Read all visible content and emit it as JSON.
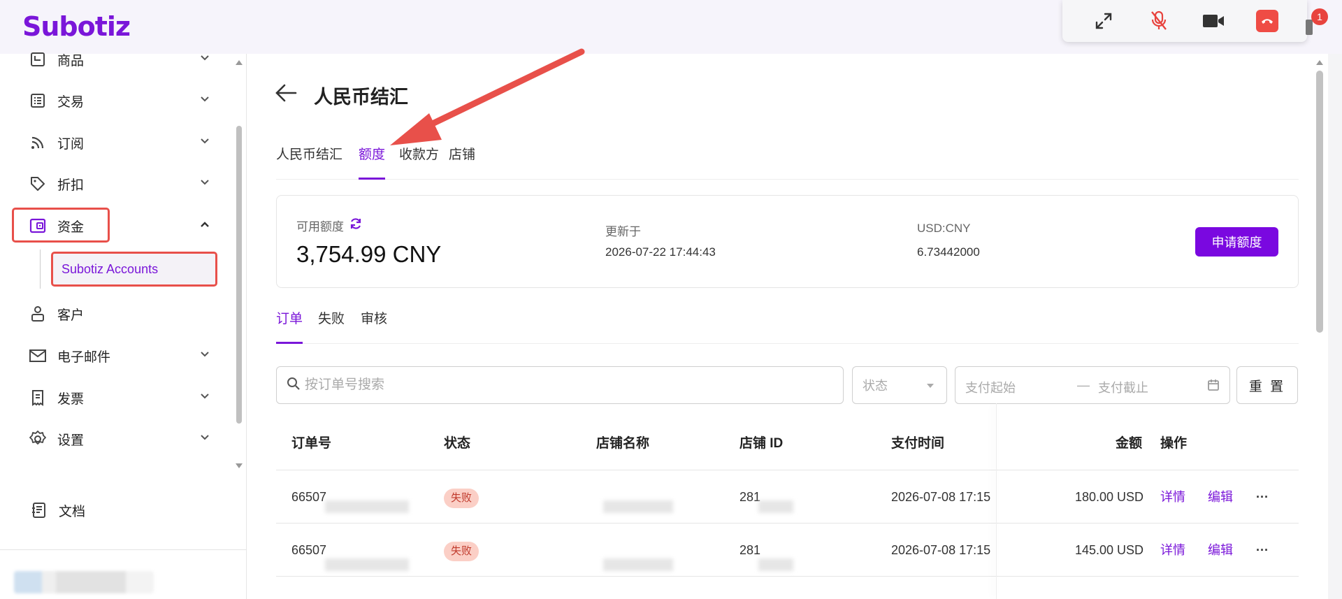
{
  "app": {
    "logo": "Subotiz"
  },
  "call": {
    "notification_count": "1"
  },
  "sidebar": {
    "items": [
      {
        "label": "商品"
      },
      {
        "label": "交易"
      },
      {
        "label": "订阅"
      },
      {
        "label": "折扣"
      },
      {
        "label": "资金"
      },
      {
        "label": "客户"
      },
      {
        "label": "电子邮件"
      },
      {
        "label": "发票"
      },
      {
        "label": "设置"
      },
      {
        "label": "文档"
      }
    ],
    "sub_item": "Subotiz Accounts"
  },
  "page": {
    "title": "人民币结汇",
    "tabs": [
      "人民币结汇",
      "额度",
      "收款方",
      "店铺"
    ],
    "active_tab": "额度"
  },
  "quota": {
    "available_label": "可用额度",
    "available_value": "3,754.99 CNY",
    "updated_label": "更新于",
    "updated_value": "2026-07-22 17:44:43",
    "rate_label": "USD:CNY",
    "rate_value": "6.73442000",
    "apply_button": "申请额度"
  },
  "subtabs": [
    "订单",
    "失败",
    "审核"
  ],
  "filters": {
    "search_placeholder": "按订单号搜索",
    "status_placeholder": "状态",
    "date_start": "支付起始",
    "date_sep": "—",
    "date_end": "支付截止",
    "reset": "重 置"
  },
  "table": {
    "headers": [
      "订单号",
      "状态",
      "店铺名称",
      "店铺 ID",
      "支付时间",
      "金额",
      "操作"
    ],
    "rows": [
      {
        "order_no": "66507",
        "status": "失败",
        "shop_id": "281",
        "pay_time": "2026-07-08 17:15",
        "amount": "180.00 USD",
        "detail": "详情",
        "edit": "编辑",
        "more": "···"
      },
      {
        "order_no": "66507",
        "status": "失败",
        "shop_id": "281",
        "pay_time": "2026-07-08 17:15",
        "amount": "145.00 USD",
        "detail": "详情",
        "edit": "编辑",
        "more": "···"
      }
    ]
  },
  "colors": {
    "brand": "#7a16d9",
    "annotation": "#e8504a"
  }
}
